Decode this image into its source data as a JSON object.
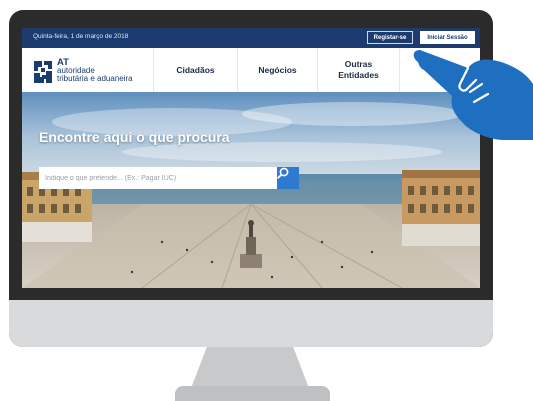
{
  "topbar": {
    "date": "Quinta-feira, 1 de março de 2018",
    "register_label": "Registar-se",
    "login_label": "Iniciar Sessão"
  },
  "logo": {
    "abbr": "AT",
    "line1": "autoridade",
    "line2": "tributária e aduaneira"
  },
  "nav": {
    "items": [
      {
        "label": "Cidadãos"
      },
      {
        "label": "Negócios"
      },
      {
        "label": "Outras Entidades"
      },
      {
        "label": ""
      }
    ]
  },
  "hero": {
    "title": "Encontre aqui o que procura"
  },
  "search": {
    "placeholder": "Indique o que pretende... (Ex.: Pagar IUC)"
  },
  "colors": {
    "brand_navy": "#1c3c70",
    "search_button": "#2f7ad1",
    "hand": "#1f6fc0"
  },
  "icons": {
    "search": "search-icon",
    "logo": "at-logo-icon",
    "pointer": "pointing-hand-icon"
  }
}
